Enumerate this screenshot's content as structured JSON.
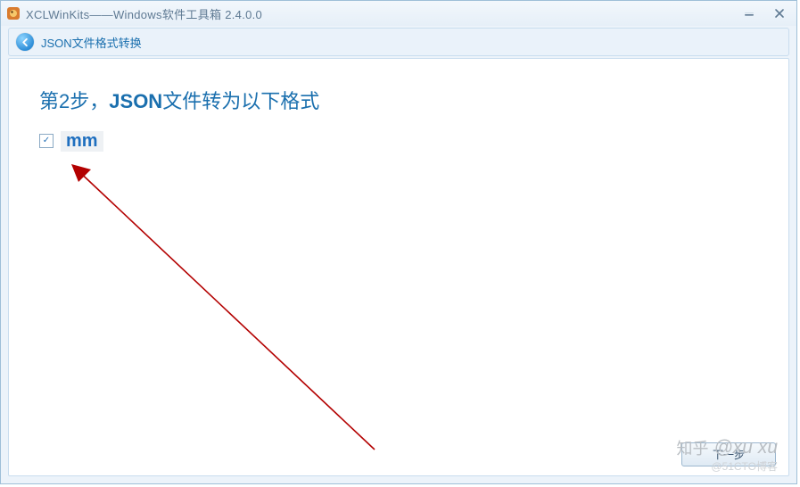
{
  "window": {
    "title": "XCLWinKits——Windows软件工具箱 2.4.0.0"
  },
  "toolbar": {
    "title": "JSON文件格式转换"
  },
  "step": {
    "prefix": "第",
    "number": "2",
    "suffix": "步，",
    "json": "JSON",
    "rest": "文件转为以下格式"
  },
  "option": {
    "checked": true,
    "label": "mm"
  },
  "buttons": {
    "next": "下一步"
  },
  "watermark": {
    "zhihu_label": "知乎",
    "author": "@xu xu",
    "site": "@51CTO博客"
  }
}
